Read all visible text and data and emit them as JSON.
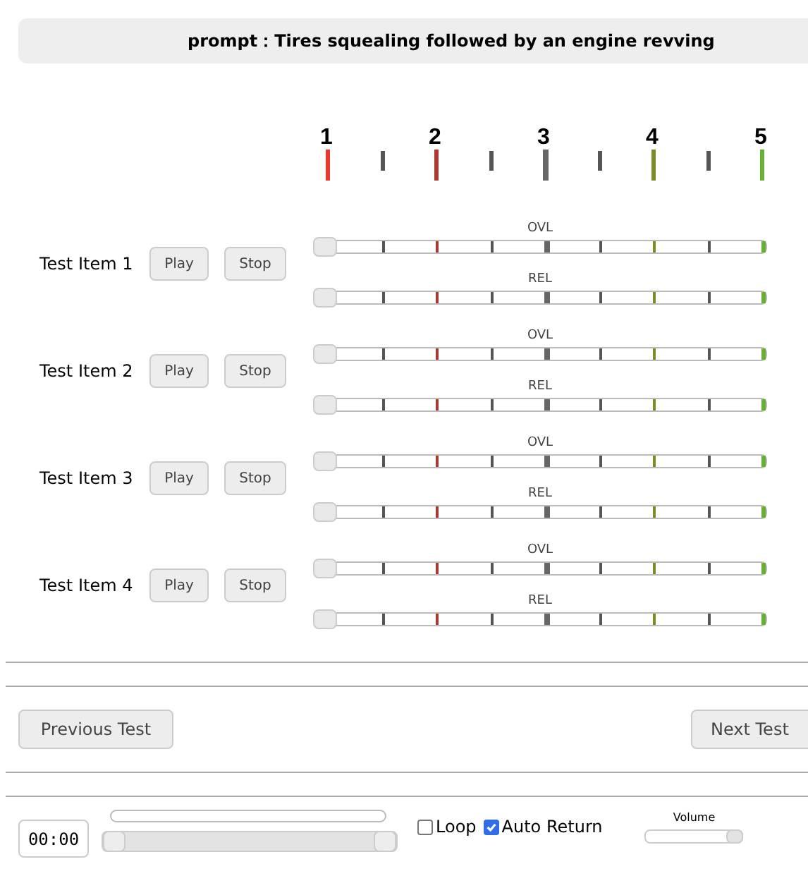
{
  "prompt": "prompt：Tires squealing followed by an engine revving",
  "scale": {
    "ticks": [
      {
        "label": "1",
        "color": "#e8392c",
        "kind": "major"
      },
      {
        "color": "#555555",
        "kind": "minor"
      },
      {
        "label": "2",
        "color": "#a83a32",
        "kind": "major"
      },
      {
        "color": "#555555",
        "kind": "minor"
      },
      {
        "label": "3",
        "color": "#666666",
        "kind": "center"
      },
      {
        "color": "#555555",
        "kind": "minor"
      },
      {
        "label": "4",
        "color": "#7b8d2b",
        "kind": "major"
      },
      {
        "color": "#555555",
        "kind": "minor"
      },
      {
        "label": "5",
        "color": "#66b133",
        "kind": "major"
      }
    ]
  },
  "items": [
    {
      "name": "Test Item 1",
      "play": "Play",
      "stop": "Stop",
      "sliders": [
        {
          "label": "OVL",
          "level": 0
        },
        {
          "label": "REL",
          "level": 0
        }
      ]
    },
    {
      "name": "Test Item 2",
      "play": "Play",
      "stop": "Stop",
      "sliders": [
        {
          "label": "OVL",
          "level": 0
        },
        {
          "label": "REL",
          "level": 0
        }
      ]
    },
    {
      "name": "Test Item 3",
      "play": "Play",
      "stop": "Stop",
      "sliders": [
        {
          "label": "OVL",
          "level": 0
        },
        {
          "label": "REL",
          "level": 0
        }
      ]
    },
    {
      "name": "Test Item 4",
      "play": "Play",
      "stop": "Stop",
      "sliders": [
        {
          "label": "OVL",
          "level": 0
        },
        {
          "label": "REL",
          "level": 0
        }
      ]
    }
  ],
  "navigation": {
    "previous": "Previous Test",
    "next": "Next Test"
  },
  "transport": {
    "time": "00:00",
    "progress": {
      "level": 0
    },
    "range": {
      "start": {
        "level": 0
      },
      "end": {
        "level": 1
      }
    },
    "options": [
      {
        "label": "Loop",
        "checked": false
      },
      {
        "label": "Auto Return",
        "checked": true
      }
    ],
    "volume": {
      "label": "Volume",
      "level": 1
    }
  }
}
